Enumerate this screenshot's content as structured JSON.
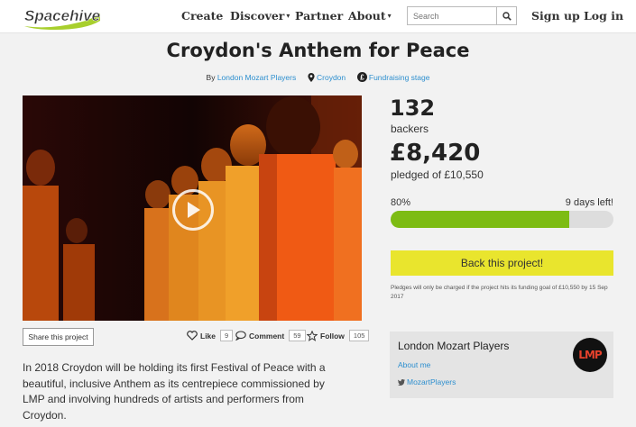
{
  "header": {
    "logo_text": "Spacehive",
    "nav": [
      {
        "label": "Create"
      },
      {
        "label": "Discover"
      },
      {
        "label": "Partner"
      },
      {
        "label": "About"
      }
    ],
    "search": {
      "placeholder": "Search",
      "value": ""
    },
    "signup_label": "Sign up",
    "login_label": "Log in",
    "icons": [
      "search-icon",
      "caret-down-icon"
    ]
  },
  "project": {
    "title": "Croydon's Anthem for Peace",
    "by_prefix": "By",
    "owner": "London Mozart Players",
    "location": "Croydon",
    "stage": "Fundraising stage"
  },
  "video": {
    "icon": "play-icon"
  },
  "actions": {
    "share_label": "Share this project",
    "like_label": "Like",
    "like_count": "9",
    "comment_label": "Comment",
    "comment_count": "59",
    "follow_label": "Follow",
    "follow_count": "105"
  },
  "description": "In 2018 Croydon will be holding its first Festival of Peace with a beautiful, inclusive Anthem as its centrepiece commissioned by LMP and involving hundreds of artists and performers from Croydon.",
  "stats": {
    "backers_count": "132",
    "backers_label": "backers",
    "pledged_amount": "£8,420",
    "pledged_label": "pledged of £10,550",
    "percent_label": "80%",
    "progress_fraction": 0.8,
    "days_left": "9 days left!"
  },
  "cta": {
    "back_label": "Back this project!",
    "fine_print": "Pledges will only be charged if the project hits its funding goal of £10,550 by 15 Sep 2017"
  },
  "organisation": {
    "name": "London Mozart Players",
    "about_link": "About me",
    "twitter_handle": "MozartPlayers",
    "logo_text": "LMP"
  },
  "colors": {
    "accent_yellow": "#e9e52d",
    "progress_green": "#7dbc13",
    "link_blue": "#2d8fcf",
    "logo_green": "#a8cf2d"
  }
}
